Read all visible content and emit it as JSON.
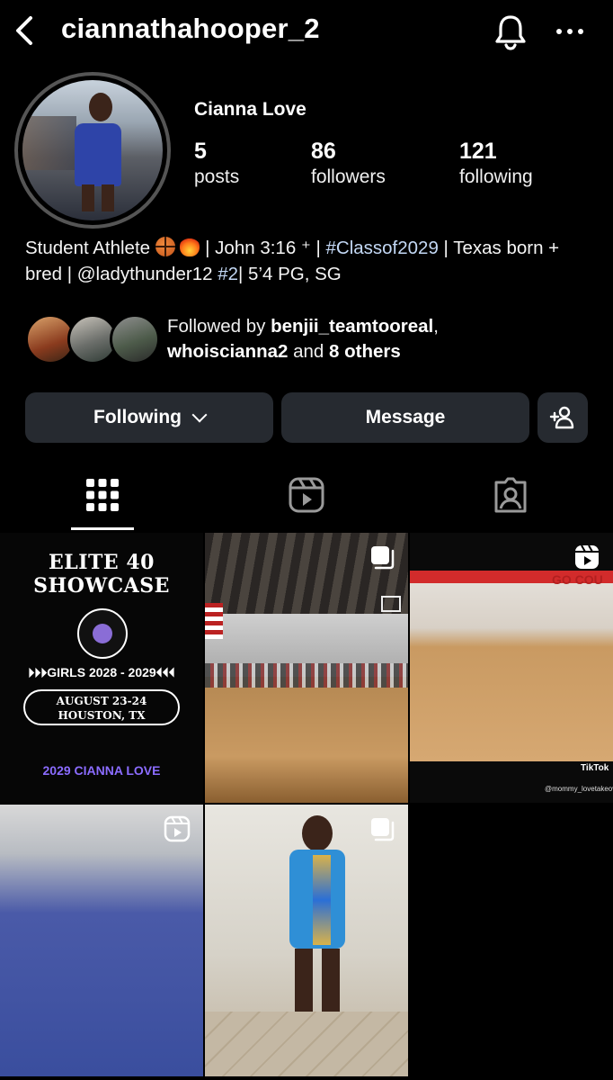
{
  "header": {
    "username": "ciannathahooper_2"
  },
  "profile": {
    "display_name": "Cianna Love",
    "stats": {
      "posts": {
        "value": "5",
        "label": "posts"
      },
      "followers": {
        "value": "86",
        "label": "followers"
      },
      "following": {
        "value": "121",
        "label": "following"
      }
    },
    "bio": {
      "part1": "Student Athlete ",
      "part2": " | John 3:16 ",
      "cross": "⁺",
      "part3": " | ",
      "hashtag": "#Classof2029",
      "part4": " | Texas born + bred | @ladythunder12 ",
      "tag2": "#2",
      "part5": "| 5’4 PG, SG"
    },
    "followed_by": {
      "prefix": "Followed by ",
      "user1": "benjii_teamtooreal",
      "sep": ", ",
      "user2": "whoiscianna2",
      "and": " and ",
      "others": "8 others"
    }
  },
  "actions": {
    "following_label": "Following",
    "message_label": "Message"
  },
  "tabs": [
    {
      "name": "grid",
      "icon": "grid-icon",
      "active": true
    },
    {
      "name": "reels",
      "icon": "reels-icon",
      "active": false
    },
    {
      "name": "tagged",
      "icon": "tagged-icon",
      "active": false
    }
  ],
  "posts": {
    "post1": {
      "title_line1": "ELITE 40",
      "title_line2": "SHOWCASE",
      "girls": "⏵⏵⏵GIRLS 2028 - 2029⏴⏴⏴",
      "date_line1": "AUGUST 23-24",
      "date_line2": "HOUSTON, TX",
      "name": "2029 CIANNA LOVE",
      "badge": "none"
    },
    "post2": {
      "badge": "carousel-icon"
    },
    "post3": {
      "court_text": "GO COU",
      "tiktok": "TikTok",
      "handle": "@mommy_lovetakeover",
      "badge": "reels-icon"
    },
    "post4": {
      "badge": "reels-icon"
    },
    "post5": {
      "badge": "carousel-icon"
    }
  },
  "colors": {
    "background": "#000000",
    "button_bg": "#262a30",
    "hashtag": "#c3d8f5",
    "elite_name": "#8b6cff"
  }
}
